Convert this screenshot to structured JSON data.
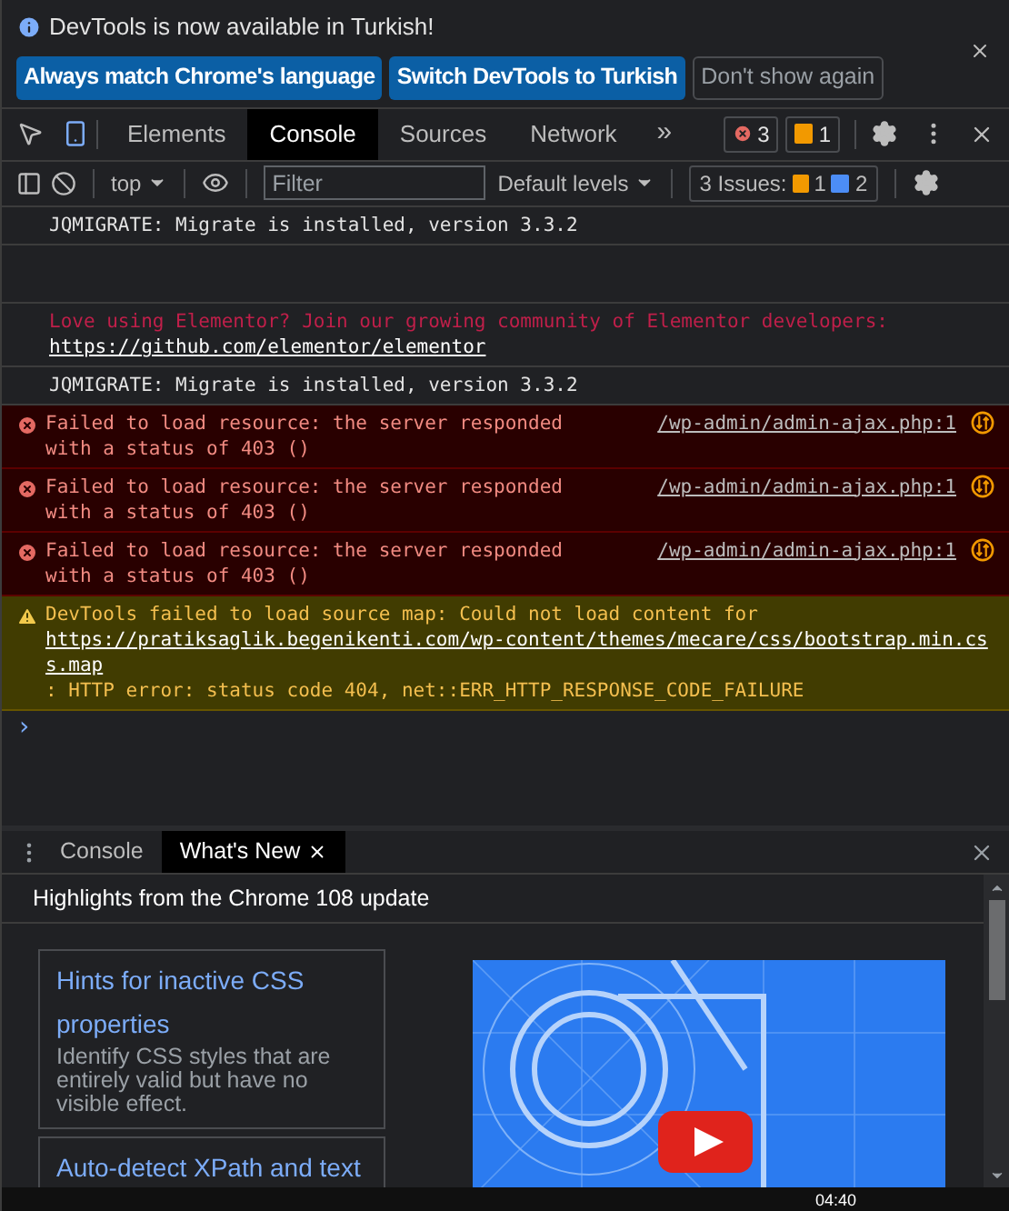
{
  "infobar": {
    "message": "DevTools is now available in Turkish!",
    "buttons": [
      {
        "label": "Always match Chrome's language",
        "kind": "primary"
      },
      {
        "label": "Switch DevTools to Turkish",
        "kind": "primary"
      },
      {
        "label": "Don't show again",
        "kind": "secondary"
      }
    ]
  },
  "tabs": [
    {
      "label": "Elements",
      "selected": false
    },
    {
      "label": "Console",
      "selected": true
    },
    {
      "label": "Sources",
      "selected": false
    },
    {
      "label": "Network",
      "selected": false
    }
  ],
  "more_tabs": "»",
  "counters": {
    "errors": "3",
    "warnings": "1"
  },
  "toolbar": {
    "context": "top",
    "filter_placeholder": "Filter",
    "levels": "Default levels",
    "issues_label": "3 Issues:",
    "issues_warnings": "1",
    "issues_info": "2"
  },
  "messages": [
    {
      "kind": "log",
      "text": "JQMIGRATE: Migrate is installed, version 3.3.2"
    },
    {
      "kind": "blank"
    },
    {
      "kind": "styled",
      "text": "Love using Elementor? Join our growing community of Elementor developers: ",
      "link": "https://github.com/elementor/elementor"
    },
    {
      "kind": "log",
      "text": "JQMIGRATE: Migrate is installed, version 3.3.2"
    },
    {
      "kind": "error",
      "text": "Failed to load resource: the server responded with a status of 403 ()",
      "source": "/wp-admin/admin-ajax.php:1"
    },
    {
      "kind": "error",
      "text": "Failed to load resource: the server responded with a status of 403 ()",
      "source": "/wp-admin/admin-ajax.php:1"
    },
    {
      "kind": "error",
      "text": "Failed to load resource: the server responded with a status of 403 ()",
      "source": "/wp-admin/admin-ajax.php:1"
    },
    {
      "kind": "warning",
      "text": "DevTools failed to load source map: Could not load content for ",
      "link": "https://pratiksaglik.begenikenti.com/wp-content/themes/mecare/css/bootstrap.min.css.map",
      "after": ": HTTP error: status code 404, net::ERR_HTTP_RESPONSE_CODE_FAILURE"
    }
  ],
  "prompt": "›",
  "drawer": {
    "tabs": [
      {
        "label": "Console",
        "selected": false
      },
      {
        "label": "What's New",
        "selected": true
      }
    ],
    "heading": "Highlights from the Chrome 108 update",
    "features": [
      {
        "title": "Hints for inactive CSS properties",
        "description": "Identify CSS styles that are entirely valid but have no visible effect."
      },
      {
        "title": "Auto-detect XPath and text"
      }
    ]
  },
  "taskbar": {
    "clock": "04:40"
  }
}
